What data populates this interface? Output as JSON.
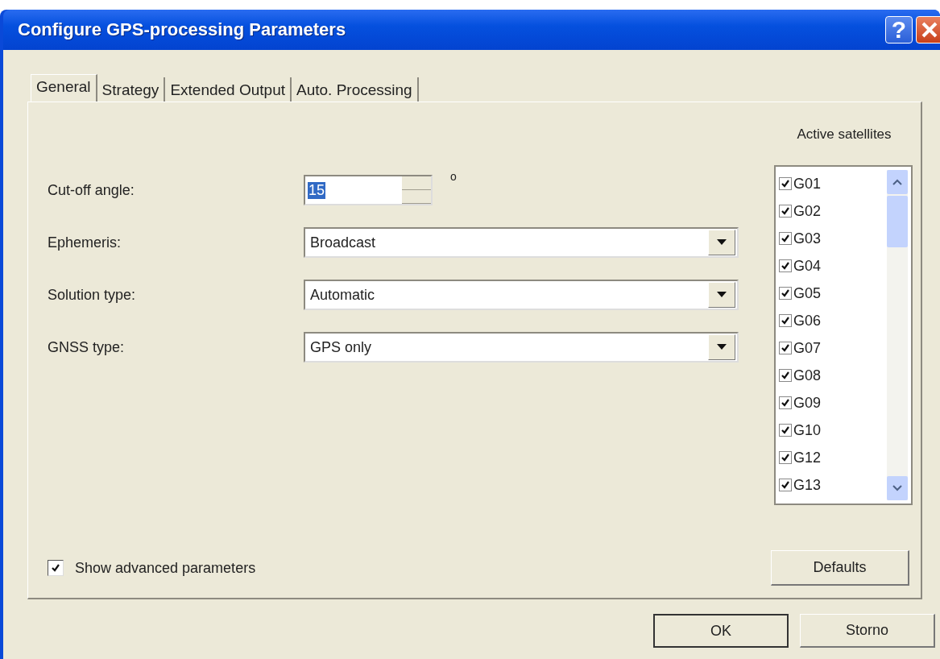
{
  "window": {
    "title": "Configure GPS-processing Parameters",
    "help_label": "?"
  },
  "tabs": [
    {
      "label": "General",
      "selected": true
    },
    {
      "label": "Strategy",
      "selected": false
    },
    {
      "label": "Extended Output",
      "selected": false
    },
    {
      "label": "Auto. Processing",
      "selected": false
    }
  ],
  "fields": [
    {
      "kind": "spin",
      "label": "Cut-off angle:",
      "value": "15",
      "unit": "o"
    },
    {
      "kind": "dropdown",
      "label": "Ephemeris:",
      "value": "Broadcast"
    },
    {
      "kind": "dropdown",
      "label": "Solution type:",
      "value": "Automatic"
    },
    {
      "kind": "dropdown",
      "label": "GNSS type:",
      "value": "GPS only"
    }
  ],
  "satellites": {
    "title": "Active satellites",
    "items": [
      {
        "label": "G01",
        "checked": true
      },
      {
        "label": "G02",
        "checked": true
      },
      {
        "label": "G03",
        "checked": true
      },
      {
        "label": "G04",
        "checked": true
      },
      {
        "label": "G05",
        "checked": true
      },
      {
        "label": "G06",
        "checked": true
      },
      {
        "label": "G07",
        "checked": true
      },
      {
        "label": "G08",
        "checked": true
      },
      {
        "label": "G09",
        "checked": true
      },
      {
        "label": "G10",
        "checked": true
      },
      {
        "label": "G12",
        "checked": true
      },
      {
        "label": "G13",
        "checked": true
      }
    ]
  },
  "show_advanced": {
    "label": "Show advanced parameters",
    "checked": true
  },
  "defaults_button": "Defaults",
  "buttons": [
    "OK",
    "Storno"
  ]
}
